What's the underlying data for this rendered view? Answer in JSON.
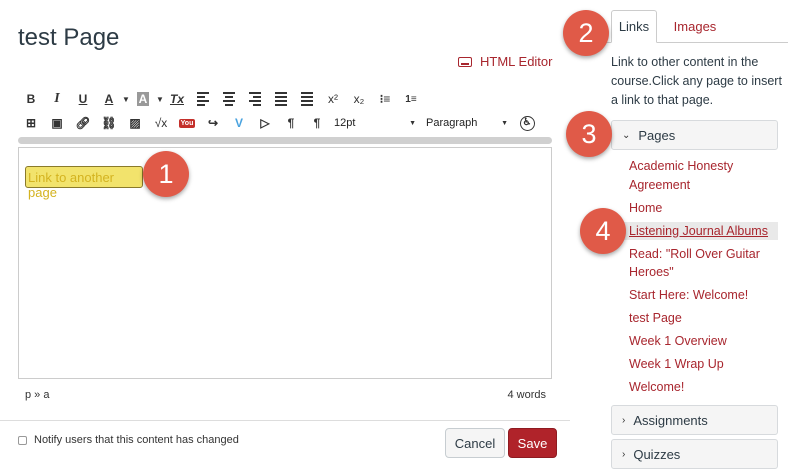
{
  "page": {
    "title": "test Page"
  },
  "editor": {
    "html_editor_label": "HTML Editor",
    "selected_text": "Link to another page",
    "toolbar_row1": [
      "B",
      "I",
      "U",
      "A",
      "A",
      "Tx"
    ],
    "font_size": "12pt",
    "block_format": "Paragraph",
    "path": "p » a",
    "word_count": "4 words"
  },
  "footer": {
    "notify_label": "Notify users that this content has changed",
    "cancel_label": "Cancel",
    "save_label": "Save"
  },
  "sidebar": {
    "tabs": [
      {
        "label": "Links"
      },
      {
        "label": "Images"
      }
    ],
    "description": "Link to other content in the course.Click any page to insert a link to that page.",
    "sections": [
      {
        "label": "Pages"
      },
      {
        "label": "Assignments"
      },
      {
        "label": "Quizzes"
      }
    ],
    "pages": [
      "Academic Honesty Agreement",
      "Home",
      "Listening Journal Albums",
      "Read: \"Roll Over Guitar Heroes\"",
      "Start Here: Welcome!",
      "test Page",
      "Week 1 Overview",
      "Week 1 Wrap Up",
      "Welcome!"
    ]
  },
  "callouts": [
    "1",
    "2",
    "3",
    "4"
  ],
  "colors": {
    "accent": "#a8262e",
    "save": "#b0232a",
    "callout": "#e05a48",
    "highlight": "#f2e36c"
  }
}
